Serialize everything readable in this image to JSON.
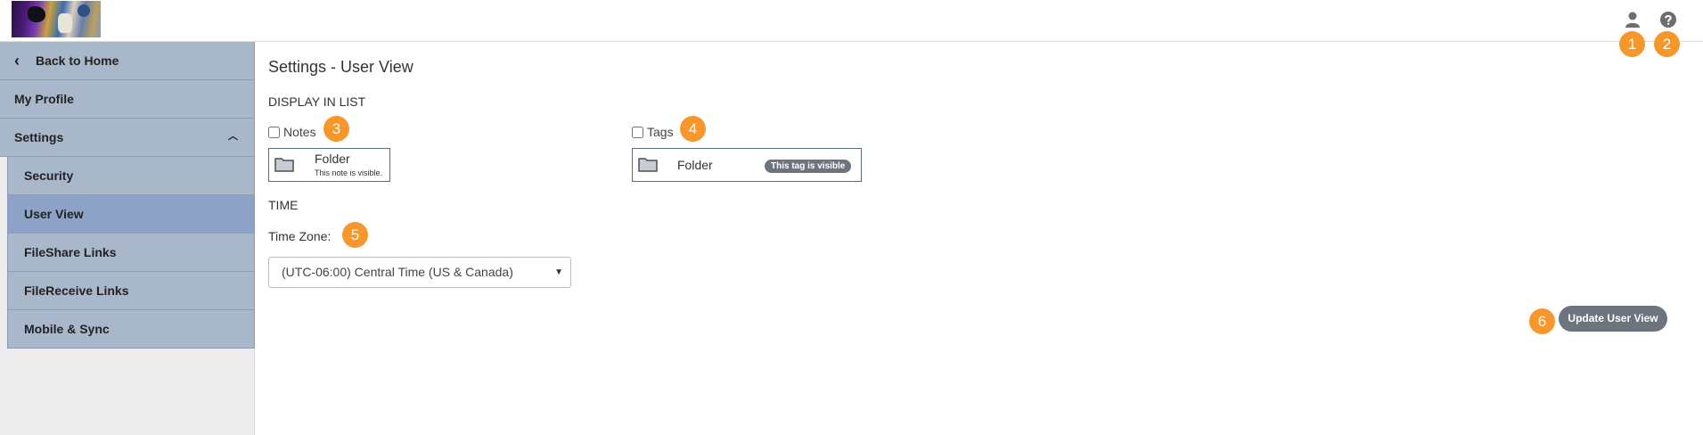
{
  "header": {
    "logo_alt": "",
    "icons": [
      "user-icon",
      "help-icon"
    ]
  },
  "annotations": {
    "b1": "1",
    "b2": "2",
    "b3": "3",
    "b4": "4",
    "b5": "5",
    "b6": "6"
  },
  "sidebar": {
    "items": [
      {
        "label": "Back to Home"
      },
      {
        "label": "My Profile"
      },
      {
        "label": "Settings"
      },
      {
        "label": "Security"
      },
      {
        "label": "User View"
      },
      {
        "label": "FileShare Links"
      },
      {
        "label": "FileReceive Links"
      },
      {
        "label": "Mobile & Sync"
      }
    ]
  },
  "main": {
    "title": "Settings - User View",
    "display_section": "DISPLAY IN LIST",
    "notes_label": "Notes",
    "notes_checked": false,
    "tags_label": "Tags",
    "tags_checked": false,
    "notes_preview": {
      "folder": "Folder",
      "note": "This note is visible."
    },
    "tags_preview": {
      "folder": "Folder",
      "tag": "This tag is visible"
    },
    "time_section": "TIME",
    "timezone_label": "Time Zone:",
    "timezone_value": "(UTC-06:00) Central Time (US & Canada)",
    "update_button": "Update User View"
  },
  "colors": {
    "sidebar_item": "#a9b7cb",
    "sidebar_active": "#8ca3c7",
    "badge": "#f7962b",
    "button": "#6c747d"
  }
}
